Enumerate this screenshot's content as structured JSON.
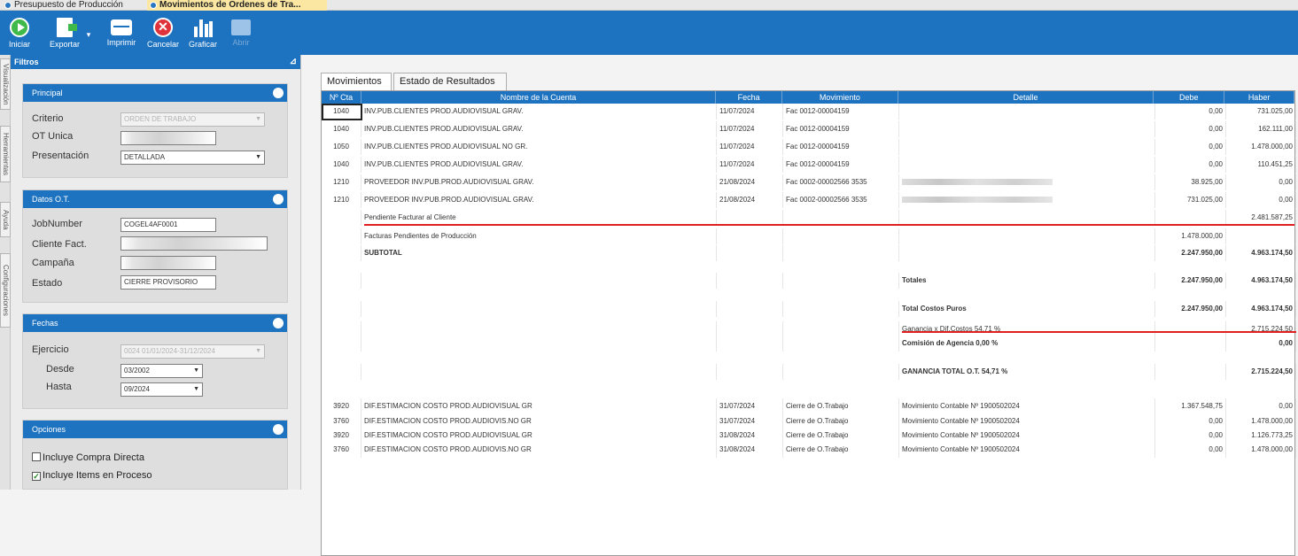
{
  "doc_tabs": [
    {
      "label": "Presupuesto de Producción",
      "active": false
    },
    {
      "label": "Movimientos de Ordenes de Tra...",
      "active": true
    }
  ],
  "toolbar": {
    "iniciar": "Iniciar",
    "exportar": "Exportar",
    "imprimir": "Imprimir",
    "cancelar": "Cancelar",
    "graficar": "Graficar",
    "abrir": "Abrir"
  },
  "side_tabs": [
    "Visualización",
    "Herramientas",
    "Ayuda",
    "Configuraciones"
  ],
  "filtros": {
    "title": "Filtros",
    "principal": {
      "title": "Principal",
      "criterio_label": "Criterio",
      "criterio_value": "ORDEN DE TRABAJO",
      "ot_label": "OT Unica",
      "presentacion_label": "Presentación",
      "presentacion_value": "DETALLADA"
    },
    "datos": {
      "title": "Datos O.T.",
      "jobnumber_label": "JobNumber",
      "jobnumber_value": "COGEL4AF0001",
      "cliente_label": "Cliente Fact.",
      "campana_label": "Campaña",
      "estado_label": "Estado",
      "estado_value": "CIERRE PROVISORIO"
    },
    "fechas": {
      "title": "Fechas",
      "ejercicio_label": "Ejercicio",
      "ejercicio_value": "0024 01/01/2024-31/12/2024",
      "desde_label": "Desde",
      "desde_value": "03/2002",
      "hasta_label": "Hasta",
      "hasta_value": "09/2024"
    },
    "opciones": {
      "title": "Opciones",
      "opt1_label": "Incluye Compra Directa",
      "opt1_checked": false,
      "opt2_label": "Incluye Items en Proceso",
      "opt2_checked": true
    }
  },
  "content_tabs": [
    {
      "label": "Movimientos",
      "active": true
    },
    {
      "label": "Estado de Resultados",
      "active": false
    }
  ],
  "grid": {
    "columns": [
      "Nº Cta",
      "Nombre de la Cuenta",
      "Fecha",
      "Movimiento",
      "Detalle",
      "Debe",
      "Haber"
    ],
    "rows": [
      {
        "cta": "1040",
        "nombre": "INV.PUB.CLIENTES PROD.AUDIOVISUAL GRAV.",
        "fecha": "11/07/2024",
        "mov": "Fac 0012-00004159",
        "detalle": "",
        "debe": "0,00",
        "haber": "731.025,00"
      },
      {
        "cta": "1040",
        "nombre": "INV.PUB.CLIENTES PROD.AUDIOVISUAL GRAV.",
        "fecha": "11/07/2024",
        "mov": "Fac 0012-00004159",
        "detalle": "",
        "debe": "0,00",
        "haber": "162.111,00"
      },
      {
        "cta": "1050",
        "nombre": "INV.PUB.CLIENTES PROD.AUDIOVISUAL NO GR.",
        "fecha": "11/07/2024",
        "mov": "Fac 0012-00004159",
        "detalle": "",
        "debe": "0,00",
        "haber": "1.478.000,00"
      },
      {
        "cta": "1040",
        "nombre": "INV.PUB.CLIENTES PROD.AUDIOVISUAL GRAV.",
        "fecha": "11/07/2024",
        "mov": "Fac 0012-00004159",
        "detalle": "",
        "debe": "0,00",
        "haber": "110.451,25"
      },
      {
        "cta": "1210",
        "nombre": "PROVEEDOR INV.PUB.PROD.AUDIOVISUAL GRAV.",
        "fecha": "21/08/2024",
        "mov": "Fac 0002-00002566 3535",
        "detalle": "",
        "debe": "38.925,00",
        "haber": "0,00"
      },
      {
        "cta": "1210",
        "nombre": "PROVEEDOR INV.PUB.PROD.AUDIOVISUAL GRAV.",
        "fecha": "21/08/2024",
        "mov": "Fac 0002-00002566 3535",
        "detalle": "",
        "debe": "731.025,00",
        "haber": "0,00"
      },
      {
        "cta": "",
        "nombre": "Pendiente Facturar al Cliente",
        "fecha": "",
        "mov": "",
        "detalle": "",
        "debe": "",
        "haber": "2.481.587,25"
      },
      {
        "cta": "",
        "nombre": "Facturas Pendientes de Producción",
        "fecha": "",
        "mov": "",
        "detalle": "",
        "debe": "1.478.000,00",
        "haber": ""
      },
      {
        "cta": "",
        "nombre": "SUBTOTAL",
        "fecha": "",
        "mov": "",
        "detalle": "",
        "debe": "2.247.950,00",
        "haber": "4.963.174,50"
      },
      {
        "cta": "",
        "nombre": "",
        "fecha": "",
        "mov": "",
        "detalle": "Totales",
        "debe": "2.247.950,00",
        "haber": "4.963.174,50"
      },
      {
        "cta": "",
        "nombre": "",
        "fecha": "",
        "mov": "",
        "detalle": "Total Costos Puros",
        "debe": "2.247.950,00",
        "haber": "4.963.174,50"
      },
      {
        "cta": "",
        "nombre": "",
        "fecha": "",
        "mov": "",
        "detalle": "Ganancia x Dif.Costos 54,71 %",
        "debe": "",
        "haber": "2.715.224,50"
      },
      {
        "cta": "",
        "nombre": "",
        "fecha": "",
        "mov": "",
        "detalle": "Comisión de Agencia 0,00 %",
        "debe": "",
        "haber": "0,00"
      },
      {
        "cta": "",
        "nombre": "",
        "fecha": "",
        "mov": "",
        "detalle": "GANANCIA TOTAL O.T. 54,71 %",
        "debe": "",
        "haber": "2.715.224,50"
      },
      {
        "cta": "3920",
        "nombre": "DIF.ESTIMACION COSTO PROD.AUDIOVISUAL GR",
        "fecha": "31/07/2024",
        "mov": "Cierre de O.Trabajo",
        "detalle": "Movimiento Contable Nº 1900502024",
        "debe": "1.367.548,75",
        "haber": "0,00"
      },
      {
        "cta": "3760",
        "nombre": "DIF.ESTIMACION COSTO PROD.AUDIOVIS.NO GR",
        "fecha": "31/07/2024",
        "mov": "Cierre de O.Trabajo",
        "detalle": "Movimiento Contable Nº 1900502024",
        "debe": "0,00",
        "haber": "1.478.000,00"
      },
      {
        "cta": "3920",
        "nombre": "DIF.ESTIMACION COSTO PROD.AUDIOVISUAL GR",
        "fecha": "31/08/2024",
        "mov": "Cierre de O.Trabajo",
        "detalle": "Movimiento Contable Nº 1900502024",
        "debe": "0,00",
        "haber": "1.126.773,25"
      },
      {
        "cta": "3760",
        "nombre": "DIF.ESTIMACION COSTO PROD.AUDIOVIS.NO GR",
        "fecha": "31/08/2024",
        "mov": "Cierre de O.Trabajo",
        "detalle": "Movimiento Contable Nº 1900502024",
        "debe": "0,00",
        "haber": "1.478.000,00"
      }
    ]
  }
}
